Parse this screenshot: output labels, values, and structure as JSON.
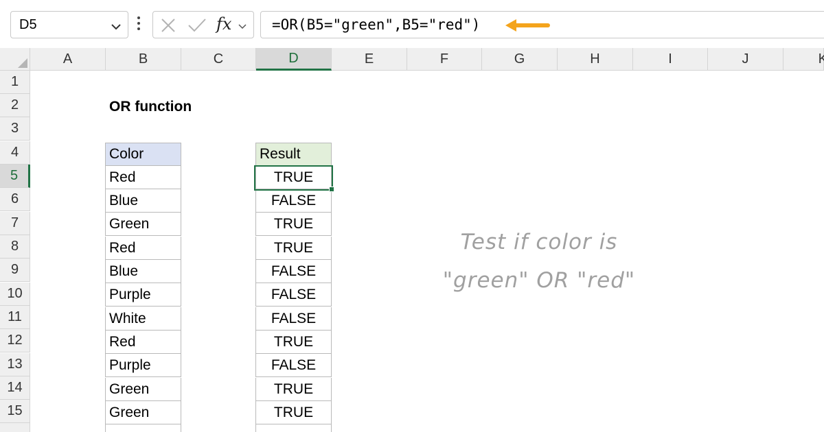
{
  "formula_bar": {
    "name_box": "D5",
    "fx_label": "fx",
    "formula": "=OR(B5=\"green\",B5=\"red\")",
    "accent_color": "#f4a41c"
  },
  "grid": {
    "columns": [
      "A",
      "B",
      "C",
      "D",
      "E",
      "F",
      "G",
      "H",
      "I",
      "J",
      "K"
    ],
    "active_column": "D",
    "rows": [
      "1",
      "2",
      "3",
      "4",
      "5",
      "6",
      "7",
      "8",
      "9",
      "10",
      "11",
      "12",
      "13",
      "14",
      "15"
    ],
    "active_row": "5",
    "selection_color": "#217346"
  },
  "sheet": {
    "title": "OR function",
    "color_header": "Color",
    "result_header": "Result",
    "colors": [
      "Red",
      "Blue",
      "Green",
      "Red",
      "Blue",
      "Purple",
      "White",
      "Red",
      "Purple",
      "Green",
      "Green"
    ],
    "results": [
      "TRUE",
      "FALSE",
      "TRUE",
      "TRUE",
      "FALSE",
      "FALSE",
      "FALSE",
      "TRUE",
      "FALSE",
      "TRUE",
      "TRUE"
    ],
    "note_line1": "Test if color is",
    "note_line2": "\"green\" OR \"red\""
  }
}
